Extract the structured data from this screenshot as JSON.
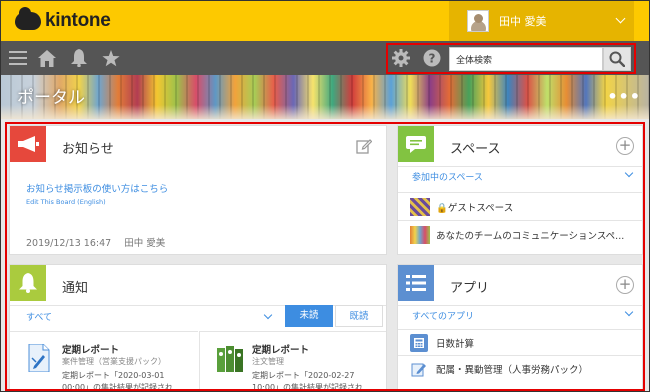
{
  "header": {
    "logo_text": "kintone",
    "user_name": "田中 愛美"
  },
  "search": {
    "placeholder": "全体検索"
  },
  "banner": {
    "title": "ポータル",
    "more": "•••"
  },
  "notice_board": {
    "title": "お知らせ",
    "link": "お知らせ掲示板の使い方はこちら",
    "sub_link": "Edit This Board (English)",
    "date": "2019/12/13 16:47",
    "author": "田中 愛美"
  },
  "spaces": {
    "title": "スペース",
    "plus": "+",
    "section": "参加中のスペース",
    "items": [
      {
        "label": "🔒ゲストスペース"
      },
      {
        "label": "あなたのチームのコミュニケーションスペ..."
      }
    ]
  },
  "notifications": {
    "title": "通知",
    "filter": "すべて",
    "unread_label": "未読",
    "read_label": "既読",
    "items": [
      {
        "title": "定期レポート",
        "app": "案件管理（営業支援パック）",
        "body_line1": "定期レポート「2020-03-01",
        "body_line2": "00:00」の集計結果が記録され"
      },
      {
        "title": "定期レポート",
        "app": "注文管理",
        "body_line1": "定期レポート「2020-02-27",
        "body_line2": "10:00」の集計結果が記録され"
      }
    ]
  },
  "apps": {
    "title": "アプリ",
    "plus": "+",
    "section": "すべてのアプリ",
    "items": [
      {
        "label": "日数計算"
      },
      {
        "label": "配属・異動管理（人事労務パック）"
      }
    ]
  },
  "colors": {
    "header_yellow": "#fdc900",
    "nav_gray": "#555555",
    "link_blue": "#3d8de1",
    "highlight_red": "#e40000",
    "notice_red": "#e6483c",
    "space_green": "#82c341",
    "notify_green": "#aacb3e",
    "app_blue": "#5c8fd1"
  }
}
